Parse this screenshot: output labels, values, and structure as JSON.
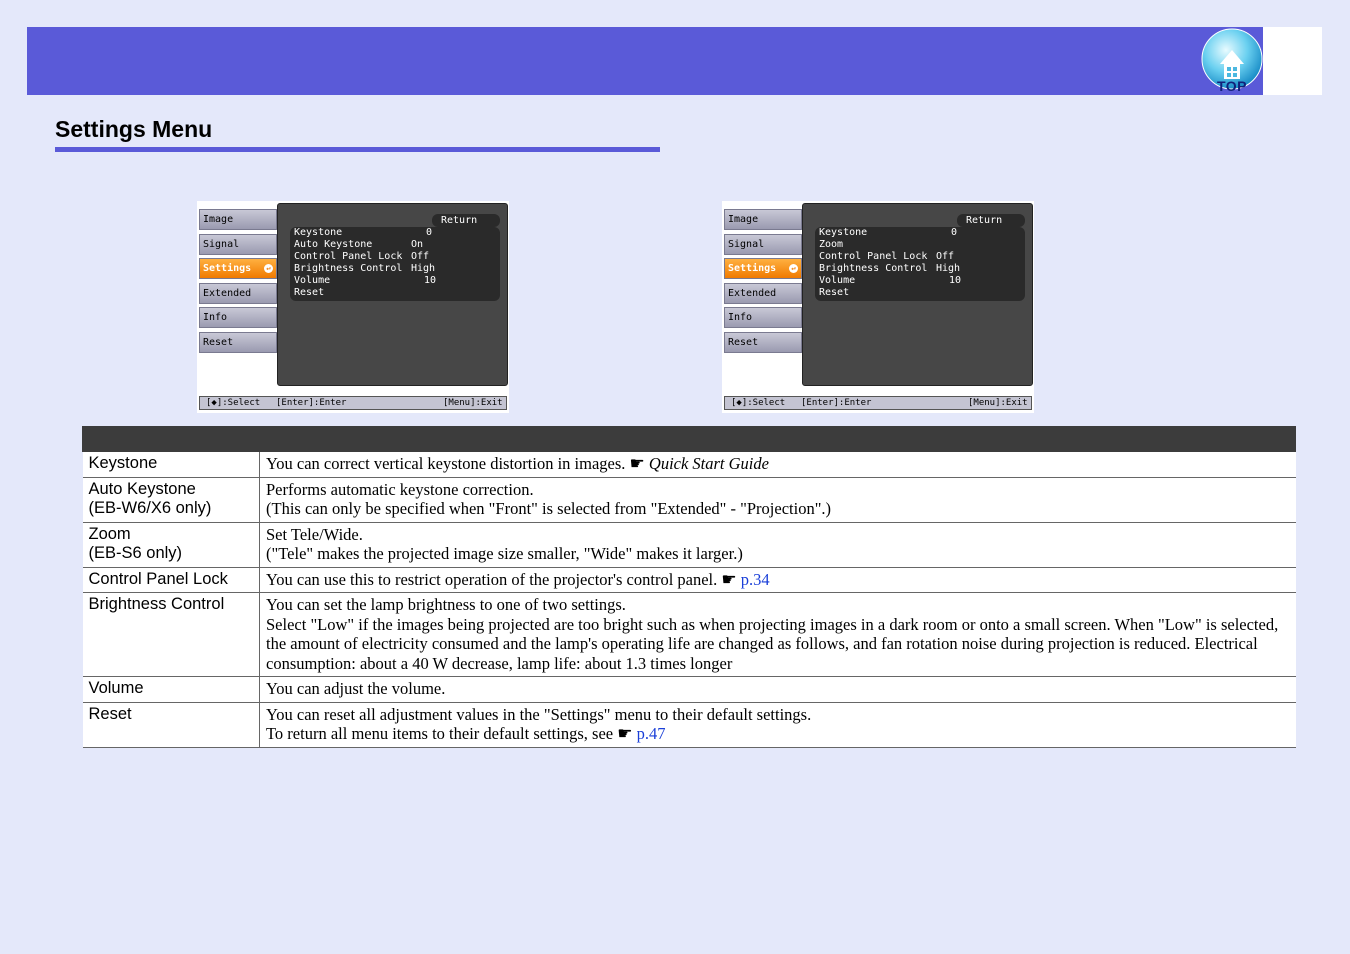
{
  "header": {
    "top_button_label": "TOP",
    "page_title": "Settings Menu"
  },
  "colors": {
    "band": "#5a5ad8",
    "page_bg": "#e4e8fa",
    "table_header": "#3c3c3c",
    "active_tab": "#f07a00",
    "link": "#1a3fd8"
  },
  "osd_left": {
    "tabs": [
      "Image",
      "Signal",
      "Settings",
      "Extended",
      "Info",
      "Reset"
    ],
    "active_tab": "Settings",
    "return_label": "Return",
    "items": [
      {
        "label": "Keystone",
        "value": "0"
      },
      {
        "label": "Auto Keystone",
        "value": "On"
      },
      {
        "label": "Control Panel Lock",
        "value": "Off"
      },
      {
        "label": "Brightness Control",
        "value": "High"
      },
      {
        "label": "Volume",
        "value": "10"
      },
      {
        "label": "Reset",
        "value": ""
      }
    ],
    "status": {
      "select": "[◆]:Select",
      "enter": "[Enter]:Enter",
      "exit": "[Menu]:Exit"
    }
  },
  "osd_right": {
    "tabs": [
      "Image",
      "Signal",
      "Settings",
      "Extended",
      "Info",
      "Reset"
    ],
    "active_tab": "Settings",
    "return_label": "Return",
    "items": [
      {
        "label": "Keystone",
        "value": "0"
      },
      {
        "label": "Zoom",
        "value": ""
      },
      {
        "label": "Control Panel Lock",
        "value": "Off"
      },
      {
        "label": "Brightness Control",
        "value": "High"
      },
      {
        "label": "Volume",
        "value": "10"
      },
      {
        "label": "Reset",
        "value": ""
      }
    ],
    "status": {
      "select": "[◆]:Select",
      "enter": "[Enter]:Enter",
      "exit": "[Menu]:Exit"
    }
  },
  "table": {
    "rows": [
      {
        "name_lines": [
          "Keystone"
        ],
        "desc": "You can correct vertical keystone distortion in images.",
        "ref_italic": "Quick Start Guide"
      },
      {
        "name_lines": [
          "Auto Keystone",
          "(EB-W6/X6 only)"
        ],
        "desc_lines": [
          "Performs automatic keystone correction.",
          "(This can only be specified when \"Front\" is selected from \"Extended\" - \"Projection\".)"
        ]
      },
      {
        "name_lines": [
          "Zoom",
          "(EB-S6 only)"
        ],
        "desc_lines": [
          "Set Tele/Wide.",
          "(\"Tele\" makes the projected image size smaller, \"Wide\" makes it larger.)"
        ]
      },
      {
        "name_lines": [
          "Control Panel Lock"
        ],
        "desc": "You can use this to restrict operation of the projector's control panel.",
        "ref_link": "p.34"
      },
      {
        "name_lines": [
          "Brightness Control"
        ],
        "desc_lines": [
          "You can set the lamp brightness to one of two settings.",
          "Select \"Low\" if the images being projected are too bright such as when projecting images in a dark room or onto a small screen. When \"Low\" is selected, the amount of electricity consumed and the lamp's operating life are changed as follows, and fan rotation noise during projection is reduced. Electrical consumption: about a 40 W decrease, lamp life: about 1.3 times longer"
        ]
      },
      {
        "name_lines": [
          "Volume"
        ],
        "desc": "You can adjust the volume."
      },
      {
        "name_lines": [
          "Reset"
        ],
        "desc_lines": [
          "You can reset all adjustment values in the \"Settings\" menu to their default settings.",
          "To return all menu items to their default settings, see"
        ],
        "ref_link": "p.47"
      }
    ]
  }
}
